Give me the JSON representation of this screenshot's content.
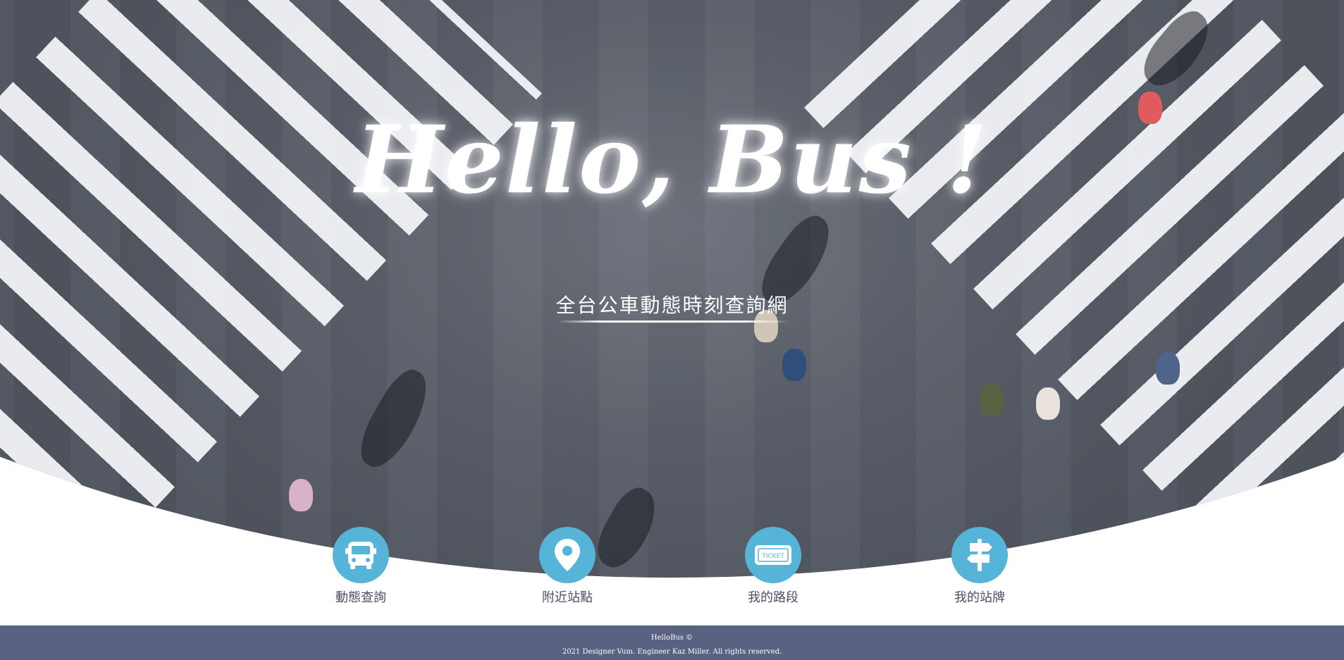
{
  "hero": {
    "title": "Hello, Bus !",
    "subtitle": "全台公車動態時刻查詢網"
  },
  "menu": {
    "items": [
      {
        "label": "動態查詢",
        "icon": "bus-icon"
      },
      {
        "label": "附近站點",
        "icon": "map-pin-icon"
      },
      {
        "label": "我的路段",
        "icon": "ticket-icon",
        "icon_text": "TICKET"
      },
      {
        "label": "我的站牌",
        "icon": "signpost-icon"
      }
    ]
  },
  "footer": {
    "brand": "HelloBus ©",
    "copyright": "2021 Designer Vum. Engineer Kaz Miller. All rights reserved."
  },
  "colors": {
    "accent": "#55b4d8",
    "footer_bg": "#596281",
    "label_text": "#4a4f63"
  }
}
